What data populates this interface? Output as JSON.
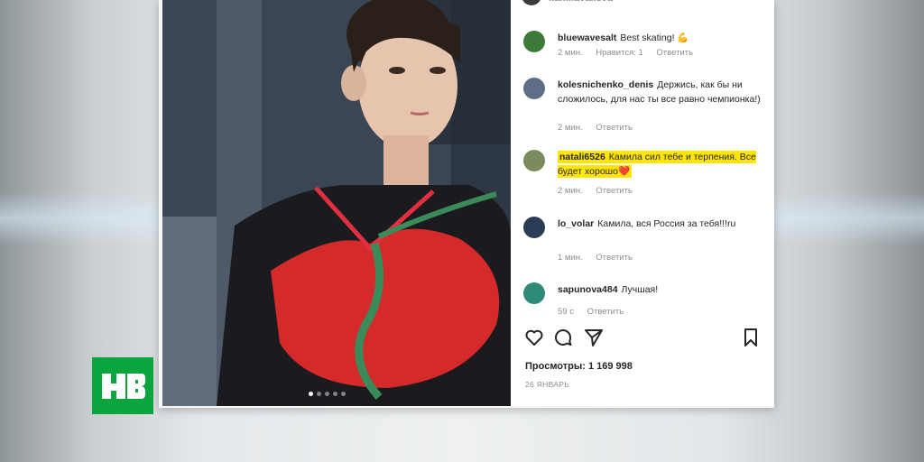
{
  "post": {
    "top_username": "kamilavalieva",
    "views_label": "Просмотры: 1 169 998",
    "date_label": "26 ЯНВАРЬ"
  },
  "comments": [
    {
      "username": "bluewavesalt",
      "text": "Best skating! 💪",
      "time": "2 мин.",
      "likes": "Нравится: 1",
      "reply": "Ответить"
    },
    {
      "username": "kolesnichenko_denis",
      "text": "Держись, как бы ни сложилось, для нас ты все равно чемпионка!)",
      "time": "2 мин.",
      "reply": "Ответить"
    },
    {
      "username": "natali6526",
      "text": "Камила сил тебе и терпения. Все будет хорошо❤️",
      "time": "2 мин.",
      "reply": "Ответить",
      "highlighted": true
    },
    {
      "username": "lo_volar",
      "text": "Камила, вся Россия за тебя!!!ru",
      "time": "1 мин.",
      "reply": "Ответить"
    },
    {
      "username": "sapunova484",
      "text": "Лучшая!",
      "time": "59 с",
      "reply": "Ответить"
    }
  ],
  "actions": {
    "like_icon": "heart-icon",
    "comment_icon": "comment-icon",
    "share_icon": "share-icon",
    "save_icon": "bookmark-icon"
  },
  "logo": {
    "text": "НТВ",
    "color": "#0aa53e"
  },
  "colors": {
    "highlight": "#ffe600",
    "meta_text": "#8e8e8e",
    "dress_red": "#d42a2a"
  }
}
